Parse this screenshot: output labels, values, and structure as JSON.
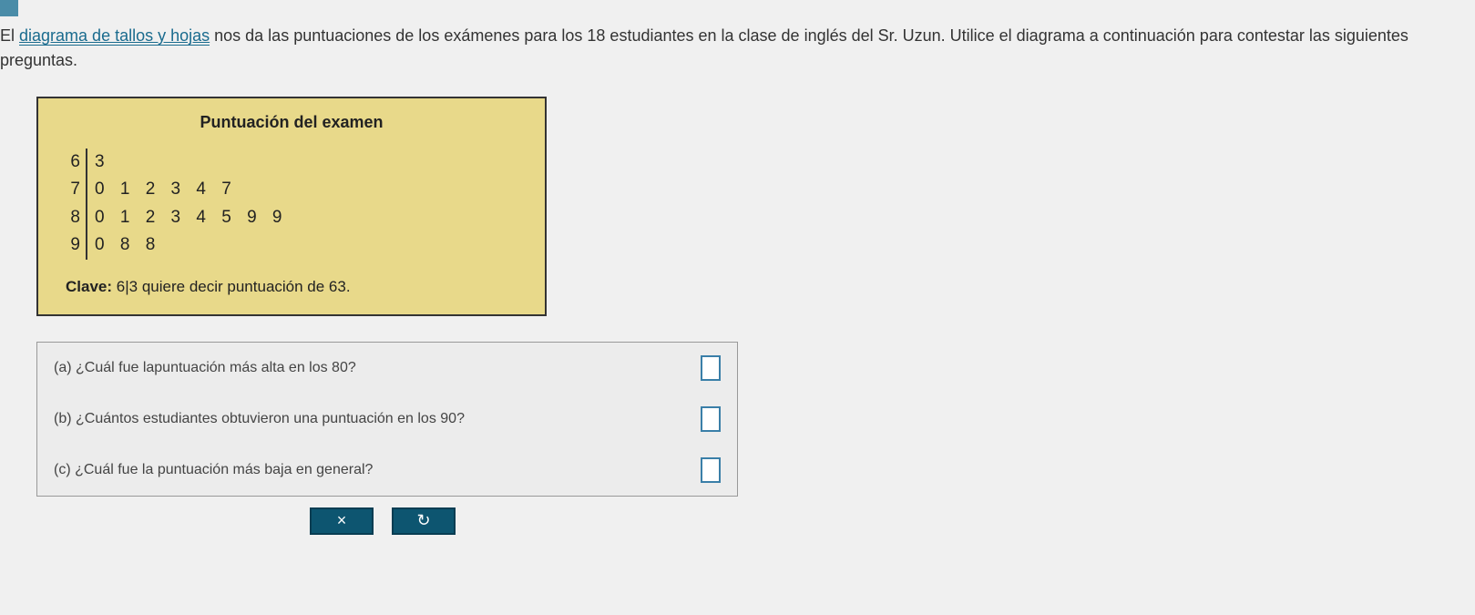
{
  "question": {
    "prefix": "El ",
    "link_text": "diagrama de tallos y hojas",
    "suffix": " nos da las puntuaciones de los exámenes para los 18 estudiantes en la clase de inglés del Sr. Uzun. Utilice el diagrama a continuación para contestar las siguientes preguntas."
  },
  "stemleaf": {
    "title": "Puntuación del examen",
    "rows": [
      {
        "stem": "6",
        "leaves": "3"
      },
      {
        "stem": "7",
        "leaves": "0 1 2 3 4 7"
      },
      {
        "stem": "8",
        "leaves": "0 1 2 3 4 5 9 9"
      },
      {
        "stem": "9",
        "leaves": "0 8 8"
      }
    ],
    "clave_label": "Clave:",
    "clave_stem": "6",
    "clave_leaf": "3",
    "clave_text": " quiere decir puntuación de 63."
  },
  "answers": {
    "a": "(a) ¿Cuál fue lapuntuación más alta en los 80?",
    "b": "(b) ¿Cuántos estudiantes obtuvieron una puntuación en los 90?",
    "c": "(c) ¿Cuál fue la puntuación más baja en general?"
  },
  "buttons": {
    "prev": "×",
    "next": "↻"
  }
}
